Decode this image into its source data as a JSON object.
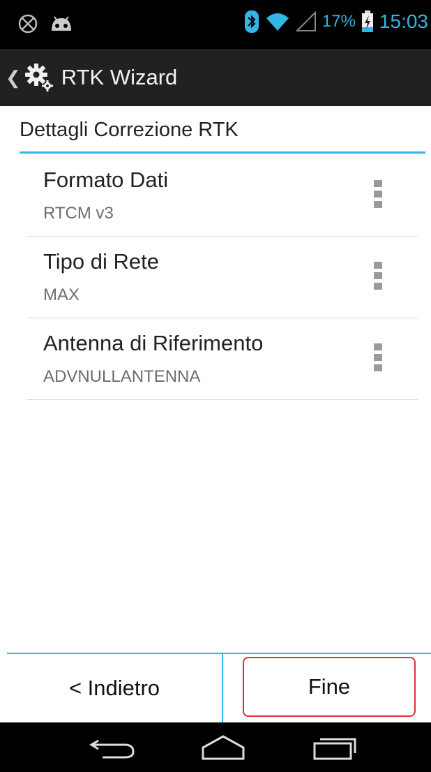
{
  "status_bar": {
    "left_icons": [
      "no-location-icon",
      "android-debug-icon"
    ],
    "right_icons": [
      "bluetooth-icon",
      "wifi-icon",
      "signal-icon",
      "battery-charging-icon"
    ],
    "battery_percent": "17%",
    "time": "15:03",
    "accent_color": "#33b5e5"
  },
  "action_bar": {
    "title": "RTK Wizard",
    "icon": "gears-icon"
  },
  "section": {
    "title": "Dettagli Correzione RTK"
  },
  "preferences": [
    {
      "title": "Formato Dati",
      "summary": "RTCM v3"
    },
    {
      "title": "Tipo di Rete",
      "summary": "MAX"
    },
    {
      "title": "Antenna di Riferimento",
      "summary": "ADVNULLANTENNA"
    }
  ],
  "buttons": {
    "back_label": "< Indietro",
    "finish_label": "Fine",
    "highlight_color": "#e0303a"
  },
  "nav_bar": {
    "icons": [
      "back-nav-icon",
      "home-nav-icon",
      "recents-nav-icon"
    ]
  }
}
